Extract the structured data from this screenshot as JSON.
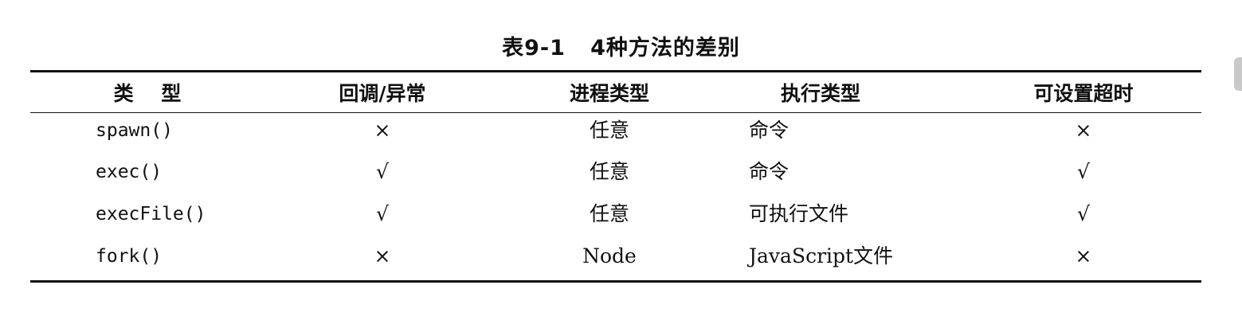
{
  "table": {
    "caption": "表9-1   4种方法的差别",
    "headers": [
      "类    型",
      "回调/异常",
      "进程类型",
      "执行类型",
      "可设置超时"
    ],
    "rows": [
      [
        "spawn()",
        "×",
        "任意",
        "命令",
        "×"
      ],
      [
        "exec()",
        "√",
        "任意",
        "命令",
        "√"
      ],
      [
        "execFile()",
        "√",
        "任意",
        "可执行文件",
        "√"
      ],
      [
        "fork()",
        "×",
        "Node",
        "JavaScript文件",
        "×"
      ]
    ]
  }
}
